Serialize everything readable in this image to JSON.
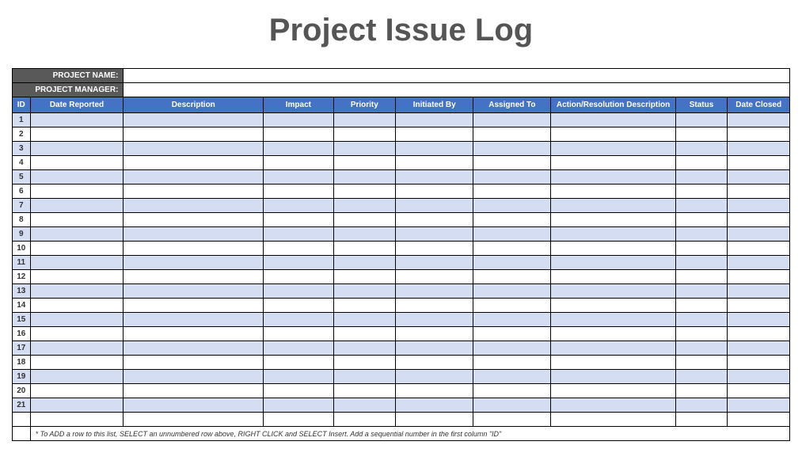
{
  "title": "Project Issue Log",
  "meta": {
    "projectNameLabel": "PROJECT NAME:",
    "projectNameValue": "",
    "projectManagerLabel": "PROJECT MANAGER:",
    "projectManagerValue": ""
  },
  "columns": {
    "id": "ID",
    "dateReported": "Date Reported",
    "description": "Description",
    "impact": "Impact",
    "priority": "Priority",
    "initiatedBy": "Initiated By",
    "assignedTo": "Assigned To",
    "action": "Action/Resolution Description",
    "status": "Status",
    "dateClosed": "Date Closed"
  },
  "rows": [
    {
      "id": "1",
      "dateReported": "",
      "description": "",
      "impact": "",
      "priority": "",
      "initiatedBy": "",
      "assignedTo": "",
      "action": "",
      "status": "",
      "dateClosed": ""
    },
    {
      "id": "2",
      "dateReported": "",
      "description": "",
      "impact": "",
      "priority": "",
      "initiatedBy": "",
      "assignedTo": "",
      "action": "",
      "status": "",
      "dateClosed": ""
    },
    {
      "id": "3",
      "dateReported": "",
      "description": "",
      "impact": "",
      "priority": "",
      "initiatedBy": "",
      "assignedTo": "",
      "action": "",
      "status": "",
      "dateClosed": ""
    },
    {
      "id": "4",
      "dateReported": "",
      "description": "",
      "impact": "",
      "priority": "",
      "initiatedBy": "",
      "assignedTo": "",
      "action": "",
      "status": "",
      "dateClosed": ""
    },
    {
      "id": "5",
      "dateReported": "",
      "description": "",
      "impact": "",
      "priority": "",
      "initiatedBy": "",
      "assignedTo": "",
      "action": "",
      "status": "",
      "dateClosed": ""
    },
    {
      "id": "6",
      "dateReported": "",
      "description": "",
      "impact": "",
      "priority": "",
      "initiatedBy": "",
      "assignedTo": "",
      "action": "",
      "status": "",
      "dateClosed": ""
    },
    {
      "id": "7",
      "dateReported": "",
      "description": "",
      "impact": "",
      "priority": "",
      "initiatedBy": "",
      "assignedTo": "",
      "action": "",
      "status": "",
      "dateClosed": ""
    },
    {
      "id": "8",
      "dateReported": "",
      "description": "",
      "impact": "",
      "priority": "",
      "initiatedBy": "",
      "assignedTo": "",
      "action": "",
      "status": "",
      "dateClosed": ""
    },
    {
      "id": "9",
      "dateReported": "",
      "description": "",
      "impact": "",
      "priority": "",
      "initiatedBy": "",
      "assignedTo": "",
      "action": "",
      "status": "",
      "dateClosed": ""
    },
    {
      "id": "10",
      "dateReported": "",
      "description": "",
      "impact": "",
      "priority": "",
      "initiatedBy": "",
      "assignedTo": "",
      "action": "",
      "status": "",
      "dateClosed": ""
    },
    {
      "id": "11",
      "dateReported": "",
      "description": "",
      "impact": "",
      "priority": "",
      "initiatedBy": "",
      "assignedTo": "",
      "action": "",
      "status": "",
      "dateClosed": ""
    },
    {
      "id": "12",
      "dateReported": "",
      "description": "",
      "impact": "",
      "priority": "",
      "initiatedBy": "",
      "assignedTo": "",
      "action": "",
      "status": "",
      "dateClosed": ""
    },
    {
      "id": "13",
      "dateReported": "",
      "description": "",
      "impact": "",
      "priority": "",
      "initiatedBy": "",
      "assignedTo": "",
      "action": "",
      "status": "",
      "dateClosed": ""
    },
    {
      "id": "14",
      "dateReported": "",
      "description": "",
      "impact": "",
      "priority": "",
      "initiatedBy": "",
      "assignedTo": "",
      "action": "",
      "status": "",
      "dateClosed": ""
    },
    {
      "id": "15",
      "dateReported": "",
      "description": "",
      "impact": "",
      "priority": "",
      "initiatedBy": "",
      "assignedTo": "",
      "action": "",
      "status": "",
      "dateClosed": ""
    },
    {
      "id": "16",
      "dateReported": "",
      "description": "",
      "impact": "",
      "priority": "",
      "initiatedBy": "",
      "assignedTo": "",
      "action": "",
      "status": "",
      "dateClosed": ""
    },
    {
      "id": "17",
      "dateReported": "",
      "description": "",
      "impact": "",
      "priority": "",
      "initiatedBy": "",
      "assignedTo": "",
      "action": "",
      "status": "",
      "dateClosed": ""
    },
    {
      "id": "18",
      "dateReported": "",
      "description": "",
      "impact": "",
      "priority": "",
      "initiatedBy": "",
      "assignedTo": "",
      "action": "",
      "status": "",
      "dateClosed": ""
    },
    {
      "id": "19",
      "dateReported": "",
      "description": "",
      "impact": "",
      "priority": "",
      "initiatedBy": "",
      "assignedTo": "",
      "action": "",
      "status": "",
      "dateClosed": ""
    },
    {
      "id": "20",
      "dateReported": "",
      "description": "",
      "impact": "",
      "priority": "",
      "initiatedBy": "",
      "assignedTo": "",
      "action": "",
      "status": "",
      "dateClosed": ""
    },
    {
      "id": "21",
      "dateReported": "",
      "description": "",
      "impact": "",
      "priority": "",
      "initiatedBy": "",
      "assignedTo": "",
      "action": "",
      "status": "",
      "dateClosed": ""
    }
  ],
  "footnote": "* To ADD a row to this list, SELECT an unnumbered row above, RIGHT CLICK and SELECT Insert. Add a sequential number in the first column \"ID\""
}
